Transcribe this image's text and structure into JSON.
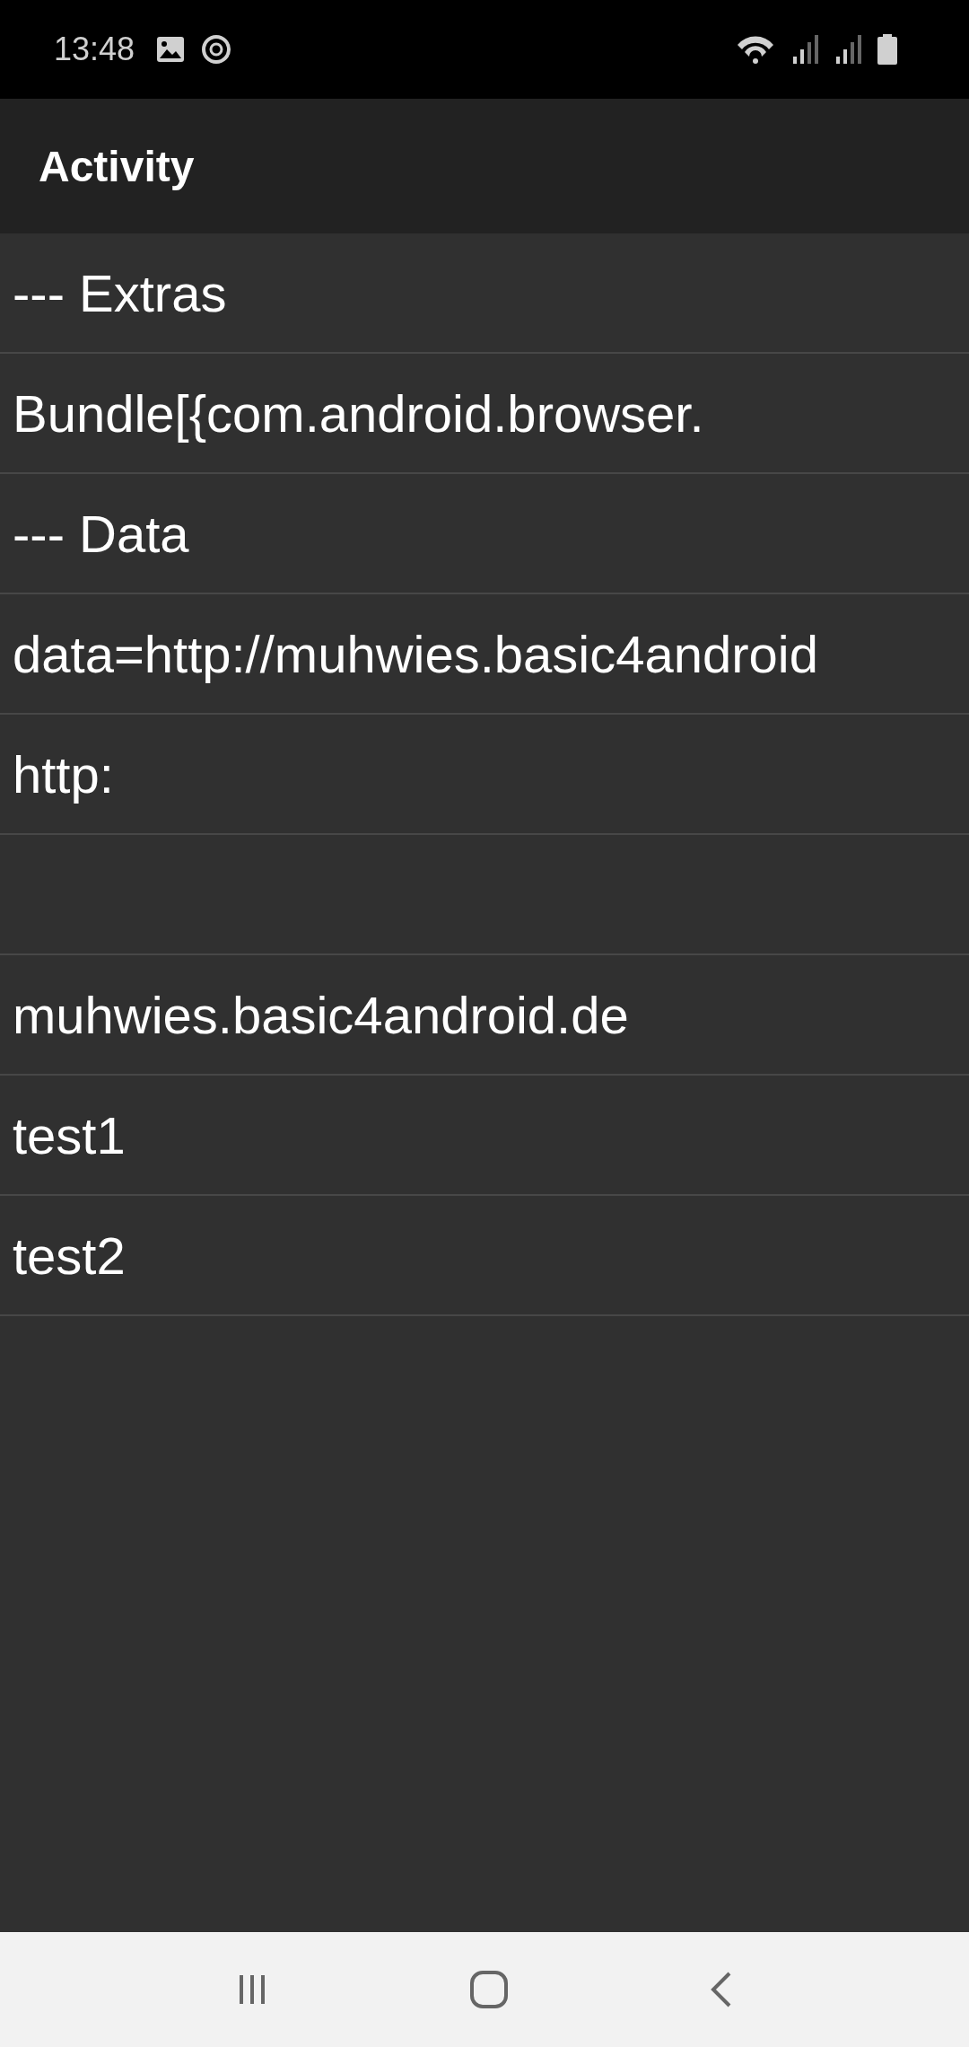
{
  "status_bar": {
    "time": "13:48"
  },
  "app_bar": {
    "title": "Activity"
  },
  "rows": [
    {
      "kind": "text",
      "text": "--- Extras"
    },
    {
      "kind": "text",
      "text": "Bundle[{com.android.browser."
    },
    {
      "kind": "text",
      "text": "--- Data"
    },
    {
      "kind": "text",
      "text": "data=http://muhwies.basic4android"
    },
    {
      "kind": "text",
      "text": "http:"
    },
    {
      "kind": "blank"
    },
    {
      "kind": "text",
      "text": "muhwies.basic4android.de"
    },
    {
      "kind": "text",
      "text": "test1"
    },
    {
      "kind": "text",
      "text": "test2"
    }
  ]
}
